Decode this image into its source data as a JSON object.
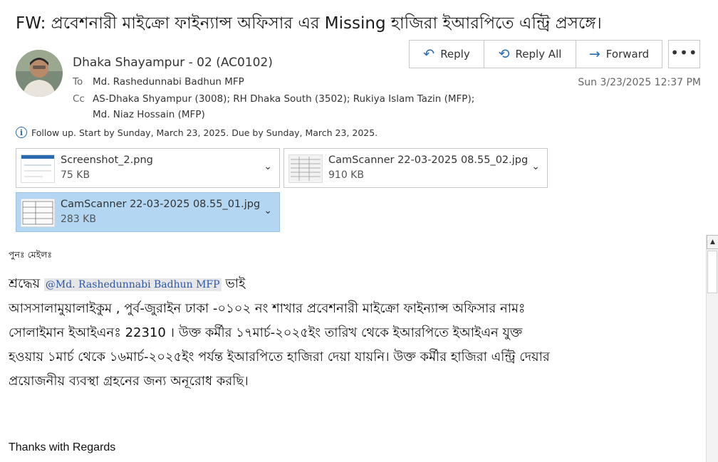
{
  "email": {
    "subject": "FW: প্রবেশনারী মাইক্রো ফাইন্যান্স অফিসার এর Missing হাজিরা ইআরপিতে এন্ট্রি প্রসঙ্গে।",
    "sender": "Dhaka Shayampur - 02 (AC0102)",
    "to_label": "To",
    "to": "Md. Rashedunnabi Badhun MFP",
    "cc_label": "Cc",
    "cc_line1": "AS-Dhaka Shyampur (3008); RH Dhaka South (3502); Rukiya Islam Tazin (MFP);",
    "cc_line2": "Md. Niaz Hossain (MFP)",
    "date": "Sun 3/23/2025 12:37 PM",
    "follow_up": "Follow up.  Start by Sunday, March 23, 2025.  Due by Sunday, March 23, 2025."
  },
  "toolbar": {
    "reply": "Reply",
    "reply_all": "Reply All",
    "forward": "Forward",
    "more": "•••"
  },
  "attachments": [
    {
      "name": "Screenshot_2.png",
      "size": "75 KB"
    },
    {
      "name": "CamScanner 22-03-2025 08.55_02.jpg",
      "size": "910 KB"
    },
    {
      "name": "CamScanner 22-03-2025 08.55_01.jpg",
      "size": "283 KB"
    }
  ],
  "body": {
    "resend": "পুনঃ মেইলঃ",
    "greeting_prefix": "শ্রদ্ধেয়",
    "mention": "@Md. Rashedunnabi Badhun MFP",
    "greeting_suffix": "ভাই",
    "line1": "আসসালামুয়ালাইকুম , পুর্ব-জুরাইন ঢাকা -০১০২ নং শাখার প্রবেশনারী মাইক্রো ফাইন্যান্স অফিসার  নামঃ",
    "line2": "সোলাইমান  ইআইএনঃ 22310 । উক্ত কর্মীর  ১৭মার্চ-২০২৫ইং তারিখ থেকে ইআরপিতে ইআইএন  যুক্ত",
    "line3": "হওয়ায় ১মার্চ  থেকে ১৬মার্চ-২০২৫ইং  পর্যন্ত ইআরপিতে হাজিরা দেয়া যায়নি। উক্ত কর্মীর হাজিরা এন্ট্রি দেয়ার",
    "line4": "প্রয়োজনীয় ব্যবস্থা গ্রহনের জন্য অনূরোধ করছি।",
    "regards": "Thanks with Regards"
  },
  "colors": {
    "accent": "#2b6cb0",
    "selected_attachment": "#b3d7f2"
  }
}
